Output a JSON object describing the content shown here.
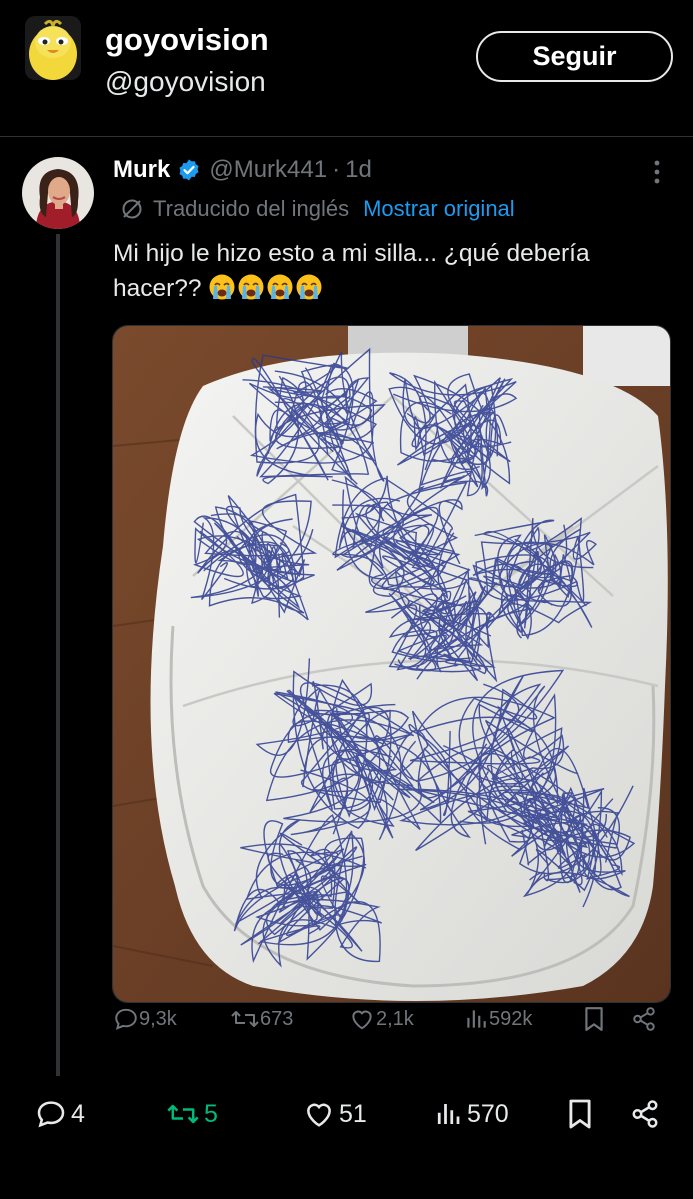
{
  "header": {
    "name": "goyovision",
    "handle": "@goyovision",
    "follow_label": "Seguir",
    "avatar": "yellow-bird-avatar"
  },
  "quoted_tweet": {
    "author_name": "Murk",
    "verified": true,
    "handle": "@Murk441",
    "separator": "·",
    "time": "1d",
    "translated_label": "Traducido del inglés",
    "show_original_label": "Mostrar original",
    "text_line1": "Mi hijo le hizo esto a mi silla... ¿qué debería",
    "text_line2": "hacer??",
    "emoji": [
      "crying-face",
      "crying-face",
      "crying-face",
      "crying-face"
    ],
    "media": "photo-white-chair-with-blue-pen-scribbles",
    "stats": {
      "replies": "9,3k",
      "retweets": "673",
      "likes": "2,1k",
      "views": "592k"
    }
  },
  "main_stats": {
    "replies": "4",
    "retweets": "5",
    "likes": "51",
    "views": "570"
  },
  "colors": {
    "background": "#000000",
    "text": "#e7e9ea",
    "muted": "#71767b",
    "link": "#1d9bf0",
    "retweet_active": "#00ba7c",
    "verified": "#1d9bf0"
  }
}
